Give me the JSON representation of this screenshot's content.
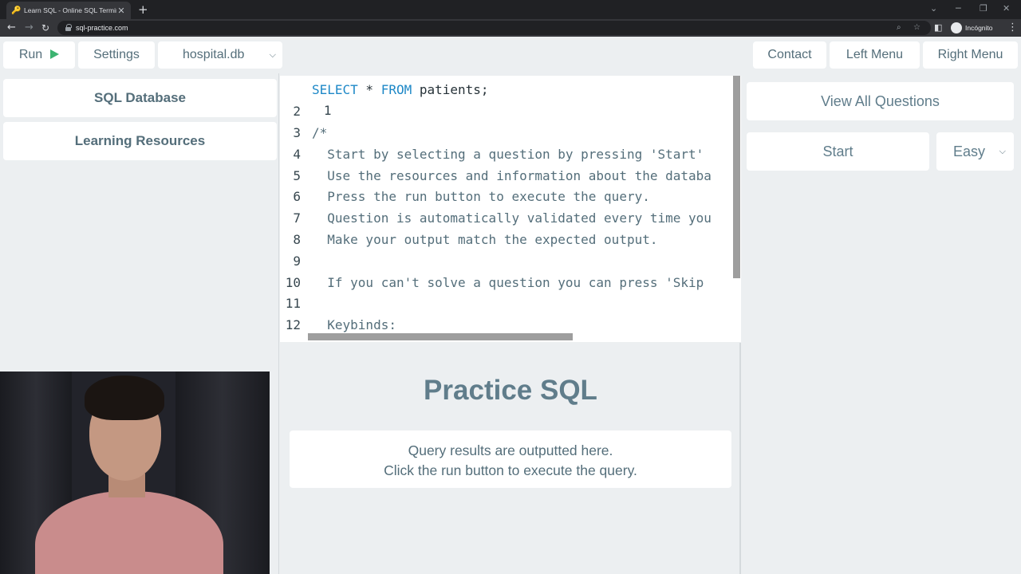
{
  "browser": {
    "tab_title": "Learn SQL - Online SQL Terminal",
    "url": "sql-practice.com",
    "profile_label": "Incógnito"
  },
  "toolbar": {
    "run_label": "Run",
    "settings_label": "Settings",
    "database_selected": "hospital.db",
    "contact_label": "Contact",
    "left_menu_label": "Left Menu",
    "right_menu_label": "Right Menu"
  },
  "left_panel": {
    "items": [
      {
        "label": "SQL Database"
      },
      {
        "label": "Learning Resources"
      }
    ]
  },
  "editor": {
    "lines": [
      {
        "n": "1",
        "kw1": "SELECT",
        "mid": " * ",
        "kw2": "FROM",
        "rest": " patients;"
      },
      {
        "n": "2",
        "text": ""
      },
      {
        "n": "3",
        "text": "/*"
      },
      {
        "n": "4",
        "text": "  Start by selecting a question by pressing 'Start'"
      },
      {
        "n": "5",
        "text": "  Use the resources and information about the databa"
      },
      {
        "n": "6",
        "text": "  Press the run button to execute the query."
      },
      {
        "n": "7",
        "text": "  Question is automatically validated every time you"
      },
      {
        "n": "8",
        "text": "  Make your output match the expected output."
      },
      {
        "n": "9",
        "text": ""
      },
      {
        "n": "10",
        "text": "  If you can't solve a question you can press 'Skip"
      },
      {
        "n": "11",
        "text": ""
      },
      {
        "n": "12",
        "text": "  Keybinds:"
      }
    ]
  },
  "output": {
    "title": "Practice SQL",
    "message_line1": "Query results are outputted here.",
    "message_line2": "Click the run button to execute the query."
  },
  "right_panel": {
    "view_all_label": "View All Questions",
    "start_label": "Start",
    "difficulty_selected": "Easy"
  },
  "colors": {
    "accent": "#546e7a",
    "keyword": "#1e88c7",
    "play": "#3cb371",
    "background": "#eceff1"
  }
}
